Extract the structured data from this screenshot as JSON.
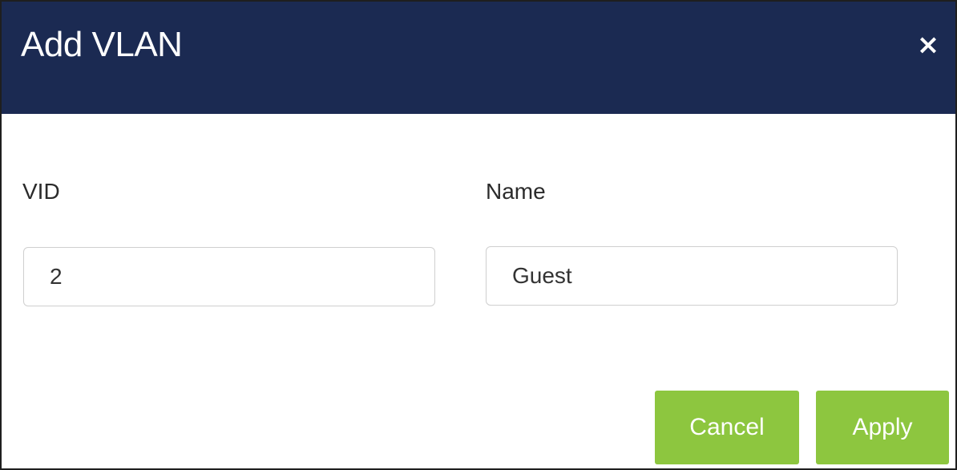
{
  "dialog": {
    "title": "Add VLAN",
    "close_glyph": "×",
    "header_color": "#1b2a52",
    "accent_color": "#8dc63f"
  },
  "form": {
    "vid": {
      "label": "VID",
      "value": "2"
    },
    "name": {
      "label": "Name",
      "value": "Guest"
    }
  },
  "actions": {
    "cancel_label": "Cancel",
    "apply_label": "Apply"
  }
}
